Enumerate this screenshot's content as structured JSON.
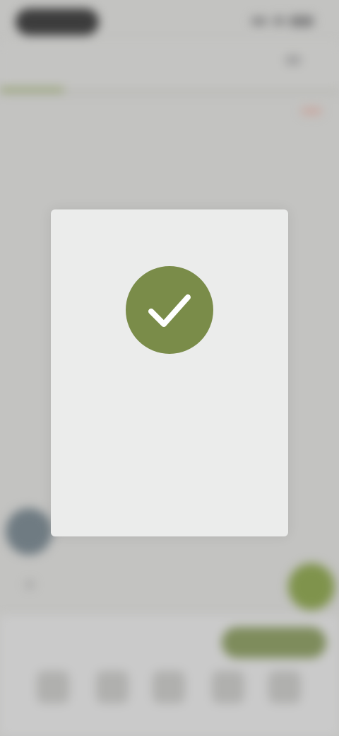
{
  "status_bar": {
    "pill_text": "",
    "icons": [
      "signal-icon",
      "wifi-icon",
      "battery-icon"
    ]
  },
  "header": {
    "title": ""
  },
  "modal": {
    "icon": "checkmark-icon",
    "accent_color": "#7a8c49",
    "title": "",
    "body": "",
    "action": ""
  },
  "bottom": {
    "center_label": "",
    "left_text": "",
    "button_label": "",
    "icons": [
      "nav-icon-1",
      "nav-icon-2",
      "nav-icon-3",
      "nav-icon-4",
      "nav-icon-5"
    ]
  },
  "colors": {
    "overlay": "#c3c3c1",
    "accent_green": "#7f934c",
    "avatar": "#6f7b82"
  }
}
